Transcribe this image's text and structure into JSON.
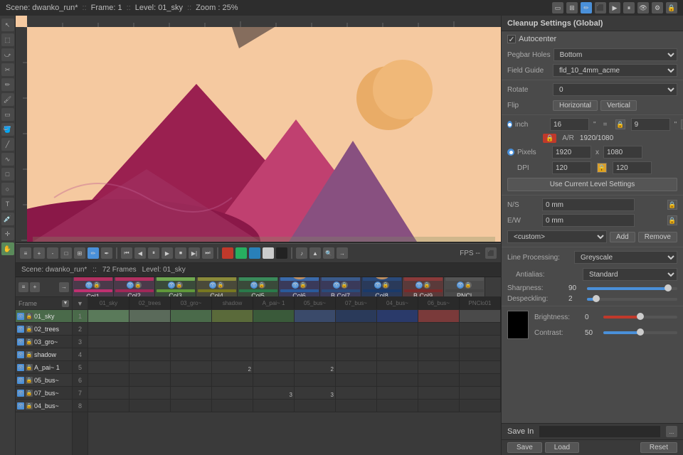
{
  "topbar": {
    "scene": "Scene: dwanko_run*",
    "frame": "Frame: 1",
    "level": "Level: 01_sky",
    "zoom": "Zoom : 25%",
    "fps": "FPS --"
  },
  "timeline_header": {
    "scene": "Scene: dwanko_run*",
    "frames": "72 Frames",
    "level": "Level: 01_sky"
  },
  "columns": [
    {
      "id": "Col1",
      "label": "Col1",
      "type": "Table",
      "color": "#d45a8a"
    },
    {
      "id": "Col2",
      "label": "Col2",
      "type": "Table",
      "color": "#b03060"
    },
    {
      "id": "Col3",
      "label": "Col3",
      "type": "Table",
      "color": "#70a850"
    },
    {
      "id": "Col4",
      "label": "Col4",
      "type": "Table",
      "color": "#8a8a3a"
    },
    {
      "id": "Col5",
      "label": "Col5",
      "type": "Table",
      "color": "#3a8a5a"
    },
    {
      "id": "Col6",
      "label": "Col6",
      "type": "Peg1",
      "color": "#3a6aaa"
    },
    {
      "id": "B Col7",
      "label": "Col7",
      "type": "Peg1",
      "color": "#3a5a8a"
    },
    {
      "id": "Col8",
      "label": "Col8",
      "type": "Peg2",
      "color": "#2a4a7a"
    },
    {
      "id": "B Col9",
      "label": "Col9",
      "type": "Peg2",
      "color": "#8a3a3a"
    },
    {
      "id": "PNCl",
      "label": "PNCl",
      "type": "Table",
      "color": "#555"
    }
  ],
  "layers": [
    {
      "num": "1",
      "name": "01_sky",
      "cells": [
        1,
        0,
        0,
        0,
        0,
        0,
        0,
        0,
        0,
        0
      ]
    },
    {
      "num": "2",
      "name": "",
      "cells": [
        0,
        0,
        0,
        0,
        0,
        0,
        0,
        0,
        0,
        0
      ]
    },
    {
      "num": "3",
      "name": "",
      "cells": [
        0,
        0,
        0,
        0,
        0,
        0,
        0,
        0,
        0,
        0
      ]
    },
    {
      "num": "4",
      "name": "",
      "cells": [
        0,
        0,
        0,
        0,
        0,
        0,
        0,
        0,
        0,
        0
      ]
    },
    {
      "num": "5",
      "name": "",
      "cells": [
        0,
        0,
        0,
        2,
        0,
        2,
        0,
        0,
        0,
        0
      ]
    },
    {
      "num": "6",
      "name": "",
      "cells": [
        0,
        0,
        0,
        0,
        0,
        0,
        0,
        0,
        0,
        0
      ]
    },
    {
      "num": "7",
      "name": "",
      "cells": [
        0,
        0,
        0,
        0,
        3,
        3,
        0,
        0,
        0,
        0
      ]
    },
    {
      "num": "8",
      "name": "",
      "cells": [
        0,
        0,
        0,
        0,
        0,
        0,
        0,
        0,
        0,
        0
      ]
    }
  ],
  "layer_names": [
    "01_sky",
    "02_trees",
    "03_gro~",
    "shadow",
    "A_pai~ 1",
    "05_bus~",
    "07_bus~",
    "04_bus~",
    "06_bus~",
    "PNClo01"
  ],
  "cleanup": {
    "title": "Cleanup Settings (Global)",
    "autocenter_label": "Autocenter",
    "pegbar_holes_label": "Pegbar Holes",
    "pegbar_holes_value": "Bottom",
    "field_guide_label": "Field Guide",
    "field_guide_value": "fld_10_4mm_acme",
    "rotate_label": "Rotate",
    "rotate_value": "0",
    "flip_label": "Flip",
    "flip_h": "Horizontal",
    "flip_v": "Vertical",
    "inch_label": "inch",
    "width_value": "16",
    "width_unit": "\"",
    "height_value": "9",
    "height_unit": "\"",
    "ar_label": "A/R",
    "ar_value": "1920/1080",
    "pixels_label": "Pixels",
    "pixel_w": "1920",
    "pixel_x": "x",
    "pixel_h": "1080",
    "dpi_label": "DPI",
    "dpi_value": "120",
    "dpi_x": "x",
    "dpi_value2": "120",
    "use_current": "Use Current Level Settings",
    "ns_label": "N/S",
    "ns_value": "0 mm",
    "ew_label": "E/W",
    "ew_value": "0 mm",
    "custom_label": "<custom>",
    "add_label": "Add",
    "remove_label": "Remove",
    "line_processing_label": "Line Processing:",
    "line_processing_value": "Greyscale",
    "antialias_label": "Antialias:",
    "antialias_value": "Standard",
    "sharpness_label": "Sharpness:",
    "sharpness_value": "90",
    "despeckling_label": "Despeckling:",
    "despeckling_value": "2",
    "brightness_label": "Brightness:",
    "brightness_value": "0",
    "contrast_label": "Contrast:",
    "contrast_value": "50",
    "save_in_label": "Save In",
    "save_label": "Save",
    "load_label": "Load",
    "reset_label": "Reset"
  }
}
